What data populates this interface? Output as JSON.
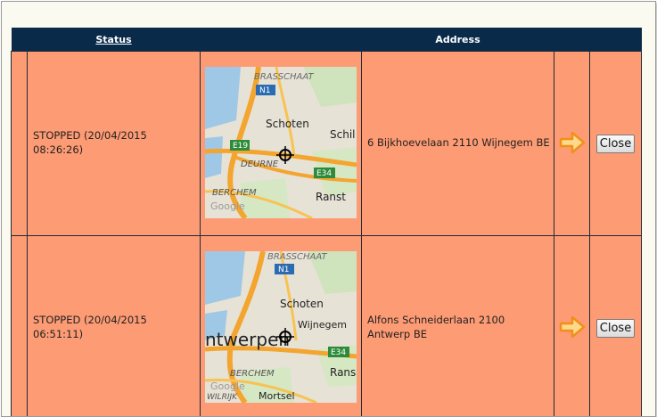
{
  "table": {
    "headers": {
      "status": "Status",
      "address": "Address"
    },
    "rows": [
      {
        "status": "STOPPED (20/04/2015 08:26:26)",
        "address": "6 Bijkhoevelaan 2110 Wijnegem BE",
        "map": {
          "labels": [
            "BRASSCHAAT",
            "N1",
            "Schoten",
            "Schil",
            "E19",
            "DEURNE",
            "E34",
            "BERCHEM",
            "Google",
            "Ranst"
          ]
        },
        "close_label": "Close"
      },
      {
        "status": "STOPPED (20/04/2015 06:51:11)",
        "address": "Alfons Schneiderlaan 2100 Antwerp BE",
        "map": {
          "labels": [
            "BRASSCHAAT",
            "N1",
            "Schoten",
            "Wijnegem",
            "ntwerpen",
            "E34",
            "BERCHEM",
            "Google",
            "WILRIJK",
            "Mortsel",
            "Rans"
          ]
        },
        "close_label": "Close"
      }
    ]
  },
  "icons": {
    "navigate": "arrow-right-icon",
    "location": "crosshair-marker-icon"
  },
  "colors": {
    "header_bg": "#0a2a4a",
    "row_bg": "#fd9b74",
    "panel_bg": "#fbfaf0",
    "arrow": "#f0901a"
  }
}
